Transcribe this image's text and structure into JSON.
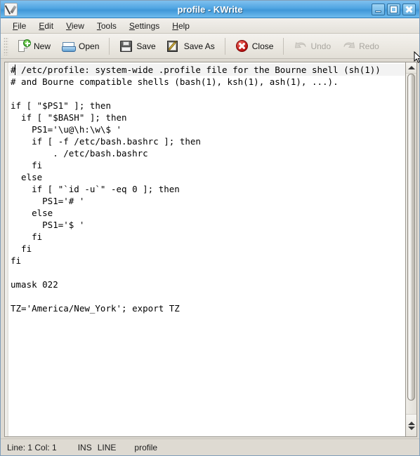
{
  "window": {
    "title": "profile - KWrite",
    "app_icon": "kwrite-document-pencil-icon",
    "buttons": {
      "minimize": "minimize-icon",
      "maximize": "maximize-icon",
      "close": "close-icon"
    }
  },
  "menubar": {
    "items": [
      {
        "label": "File",
        "accel": "F"
      },
      {
        "label": "Edit",
        "accel": "E"
      },
      {
        "label": "View",
        "accel": "V"
      },
      {
        "label": "Tools",
        "accel": "T"
      },
      {
        "label": "Settings",
        "accel": "S"
      },
      {
        "label": "Help",
        "accel": "H"
      }
    ]
  },
  "toolbar": {
    "new_label": "New",
    "open_label": "Open",
    "save_label": "Save",
    "saveas_label": "Save As",
    "close_label": "Close",
    "undo_label": "Undo",
    "redo_label": "Redo",
    "undo_enabled": false,
    "redo_enabled": false,
    "icons": {
      "new": "new-document-icon",
      "open": "open-folder-icon",
      "save": "floppy-disk-icon",
      "saveas": "floppy-disk-pencil-icon",
      "close": "red-x-circle-icon",
      "undo": "undo-arrow-icon",
      "redo": "redo-arrow-icon"
    }
  },
  "editor": {
    "filename": "profile",
    "wrap_marker": "»",
    "lines": [
      "# /etc/profile: system-wide .profile file for the Bourne shell (sh(1))",
      "# and Bourne compatible shells (bash(1), ksh(1), ash(1), ...).",
      "",
      "if [ \"$PS1\" ]; then",
      "  if [ \"$BASH\" ]; then",
      "    PS1='\\u@\\h:\\w\\$ '",
      "    if [ -f /etc/bash.bashrc ]; then",
      "        . /etc/bash.bashrc",
      "    fi",
      "  else",
      "    if [ \"`id -u`\" -eq 0 ]; then",
      "      PS1='# '",
      "    else",
      "      PS1='$ '",
      "    fi",
      "  fi",
      "fi",
      "",
      "umask 022",
      "",
      "TZ='America/New_York'; export TZ"
    ],
    "wrap_marker_line_index": 7,
    "cursor_line_index": 0
  },
  "scrollbar": {
    "up_arrow": "scroll-up-arrow-icon",
    "down_arrow": "scroll-down-arrow-icon",
    "thumb_top_pct": 0,
    "thumb_height_pct": 96
  },
  "statusbar": {
    "position": "Line: 1 Col: 1",
    "insert_mode": "INS",
    "selection_mode": "LINE",
    "document_name": "profile"
  },
  "colors": {
    "titlebar_accent": "#4ca2dd",
    "toolbar_bg": "#ebe8e1",
    "window_bg": "#dedad2",
    "editor_bg": "#ffffff",
    "text": "#000000",
    "disabled_text": "#a9a6a0",
    "close_icon": "#b50d0d",
    "new_plus": "#2f9b22"
  }
}
